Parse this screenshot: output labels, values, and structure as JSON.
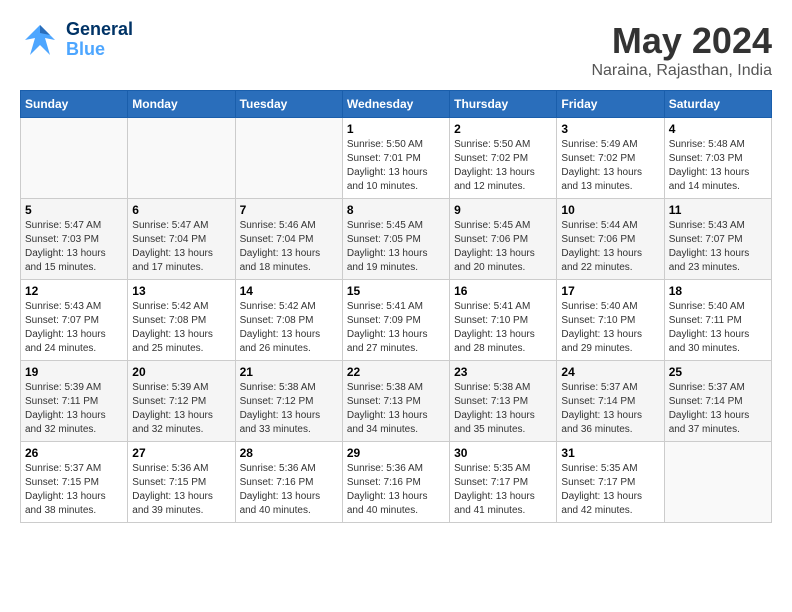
{
  "header": {
    "logo": {
      "line1": "General",
      "line2": "Blue"
    },
    "title": "May 2024",
    "location": "Naraina, Rajasthan, India"
  },
  "weekdays": [
    "Sunday",
    "Monday",
    "Tuesday",
    "Wednesday",
    "Thursday",
    "Friday",
    "Saturday"
  ],
  "weeks": [
    [
      {
        "day": "",
        "info": ""
      },
      {
        "day": "",
        "info": ""
      },
      {
        "day": "",
        "info": ""
      },
      {
        "day": "1",
        "info": "Sunrise: 5:50 AM\nSunset: 7:01 PM\nDaylight: 13 hours\nand 10 minutes."
      },
      {
        "day": "2",
        "info": "Sunrise: 5:50 AM\nSunset: 7:02 PM\nDaylight: 13 hours\nand 12 minutes."
      },
      {
        "day": "3",
        "info": "Sunrise: 5:49 AM\nSunset: 7:02 PM\nDaylight: 13 hours\nand 13 minutes."
      },
      {
        "day": "4",
        "info": "Sunrise: 5:48 AM\nSunset: 7:03 PM\nDaylight: 13 hours\nand 14 minutes."
      }
    ],
    [
      {
        "day": "5",
        "info": "Sunrise: 5:47 AM\nSunset: 7:03 PM\nDaylight: 13 hours\nand 15 minutes."
      },
      {
        "day": "6",
        "info": "Sunrise: 5:47 AM\nSunset: 7:04 PM\nDaylight: 13 hours\nand 17 minutes."
      },
      {
        "day": "7",
        "info": "Sunrise: 5:46 AM\nSunset: 7:04 PM\nDaylight: 13 hours\nand 18 minutes."
      },
      {
        "day": "8",
        "info": "Sunrise: 5:45 AM\nSunset: 7:05 PM\nDaylight: 13 hours\nand 19 minutes."
      },
      {
        "day": "9",
        "info": "Sunrise: 5:45 AM\nSunset: 7:06 PM\nDaylight: 13 hours\nand 20 minutes."
      },
      {
        "day": "10",
        "info": "Sunrise: 5:44 AM\nSunset: 7:06 PM\nDaylight: 13 hours\nand 22 minutes."
      },
      {
        "day": "11",
        "info": "Sunrise: 5:43 AM\nSunset: 7:07 PM\nDaylight: 13 hours\nand 23 minutes."
      }
    ],
    [
      {
        "day": "12",
        "info": "Sunrise: 5:43 AM\nSunset: 7:07 PM\nDaylight: 13 hours\nand 24 minutes."
      },
      {
        "day": "13",
        "info": "Sunrise: 5:42 AM\nSunset: 7:08 PM\nDaylight: 13 hours\nand 25 minutes."
      },
      {
        "day": "14",
        "info": "Sunrise: 5:42 AM\nSunset: 7:08 PM\nDaylight: 13 hours\nand 26 minutes."
      },
      {
        "day": "15",
        "info": "Sunrise: 5:41 AM\nSunset: 7:09 PM\nDaylight: 13 hours\nand 27 minutes."
      },
      {
        "day": "16",
        "info": "Sunrise: 5:41 AM\nSunset: 7:10 PM\nDaylight: 13 hours\nand 28 minutes."
      },
      {
        "day": "17",
        "info": "Sunrise: 5:40 AM\nSunset: 7:10 PM\nDaylight: 13 hours\nand 29 minutes."
      },
      {
        "day": "18",
        "info": "Sunrise: 5:40 AM\nSunset: 7:11 PM\nDaylight: 13 hours\nand 30 minutes."
      }
    ],
    [
      {
        "day": "19",
        "info": "Sunrise: 5:39 AM\nSunset: 7:11 PM\nDaylight: 13 hours\nand 32 minutes."
      },
      {
        "day": "20",
        "info": "Sunrise: 5:39 AM\nSunset: 7:12 PM\nDaylight: 13 hours\nand 32 minutes."
      },
      {
        "day": "21",
        "info": "Sunrise: 5:38 AM\nSunset: 7:12 PM\nDaylight: 13 hours\nand 33 minutes."
      },
      {
        "day": "22",
        "info": "Sunrise: 5:38 AM\nSunset: 7:13 PM\nDaylight: 13 hours\nand 34 minutes."
      },
      {
        "day": "23",
        "info": "Sunrise: 5:38 AM\nSunset: 7:13 PM\nDaylight: 13 hours\nand 35 minutes."
      },
      {
        "day": "24",
        "info": "Sunrise: 5:37 AM\nSunset: 7:14 PM\nDaylight: 13 hours\nand 36 minutes."
      },
      {
        "day": "25",
        "info": "Sunrise: 5:37 AM\nSunset: 7:14 PM\nDaylight: 13 hours\nand 37 minutes."
      }
    ],
    [
      {
        "day": "26",
        "info": "Sunrise: 5:37 AM\nSunset: 7:15 PM\nDaylight: 13 hours\nand 38 minutes."
      },
      {
        "day": "27",
        "info": "Sunrise: 5:36 AM\nSunset: 7:15 PM\nDaylight: 13 hours\nand 39 minutes."
      },
      {
        "day": "28",
        "info": "Sunrise: 5:36 AM\nSunset: 7:16 PM\nDaylight: 13 hours\nand 40 minutes."
      },
      {
        "day": "29",
        "info": "Sunrise: 5:36 AM\nSunset: 7:16 PM\nDaylight: 13 hours\nand 40 minutes."
      },
      {
        "day": "30",
        "info": "Sunrise: 5:35 AM\nSunset: 7:17 PM\nDaylight: 13 hours\nand 41 minutes."
      },
      {
        "day": "31",
        "info": "Sunrise: 5:35 AM\nSunset: 7:17 PM\nDaylight: 13 hours\nand 42 minutes."
      },
      {
        "day": "",
        "info": ""
      }
    ]
  ]
}
